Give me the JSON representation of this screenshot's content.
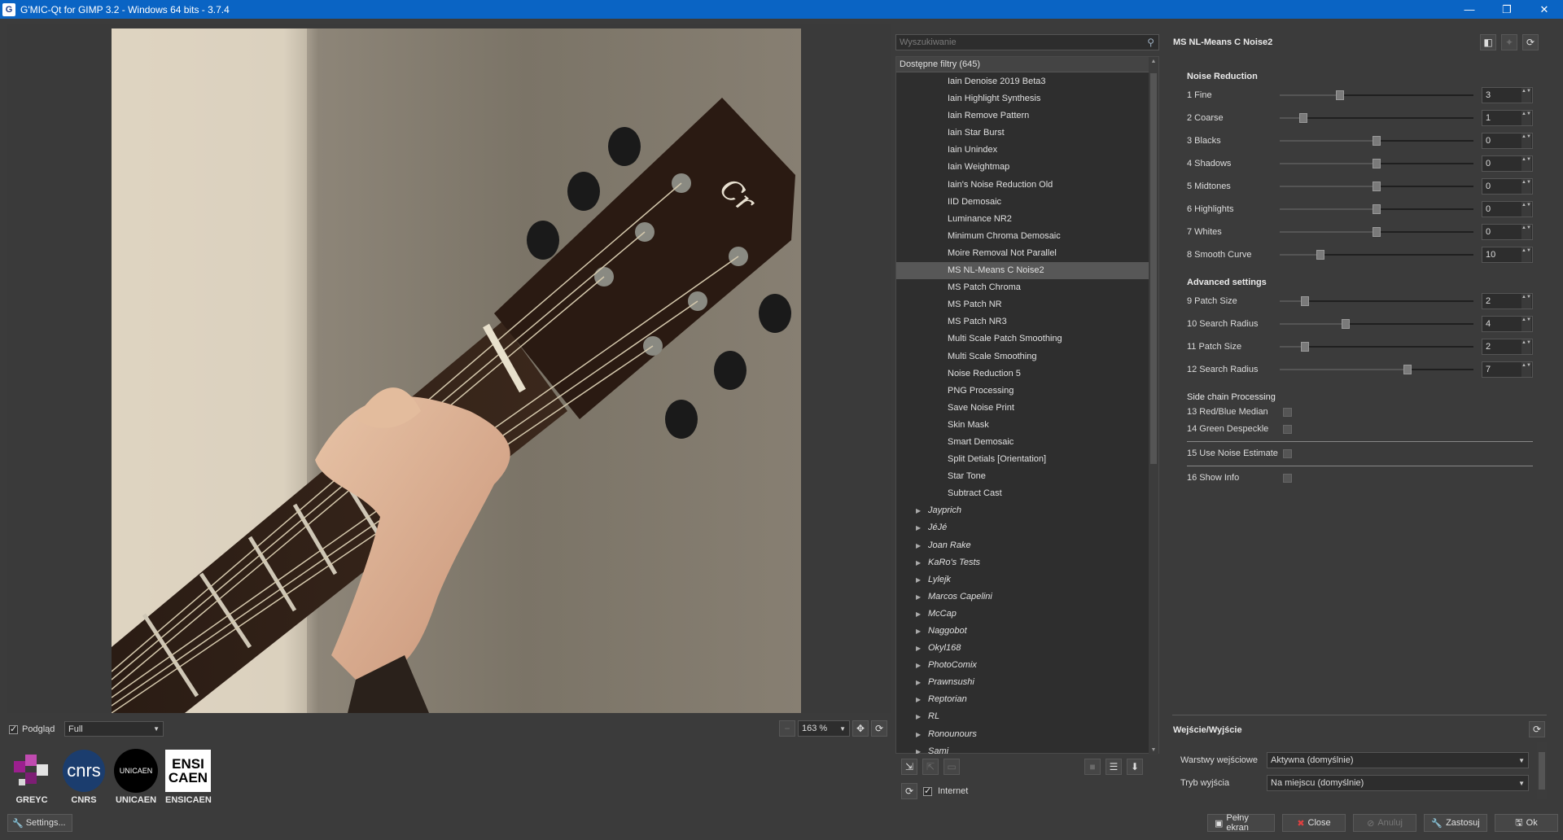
{
  "window": {
    "title": "G'MIC-Qt for GIMP 3.2 - Windows 64 bits - 3.7.4",
    "app_icon": "G",
    "minimize": "—",
    "maximize": "❐",
    "close": "✕"
  },
  "preview": {
    "checkbox_label": "Podgląd",
    "mode_value": "Full",
    "zoom_value": "163 %",
    "zoom_out_glyph": "−",
    "zoom_fit_glyph": "✥",
    "refresh_glyph": "⟳",
    "image_description": "guitar-headstock-photo"
  },
  "logos": [
    {
      "name": "GREYC"
    },
    {
      "name": "CNRS",
      "mark": "cnrs"
    },
    {
      "name": "UNICAEN",
      "mark": "UNICAEN"
    },
    {
      "name": "ENSICAEN",
      "mark_top": "ENSI",
      "mark_bottom": "CAEN"
    }
  ],
  "settings_button": "Settings...",
  "search": {
    "placeholder": "Wyszukiwanie",
    "icon": "⚲"
  },
  "filters": {
    "header": "Dostępne filtry (645)",
    "items": [
      {
        "label": "Iain Denoise 2019 Beta3",
        "type": "filter"
      },
      {
        "label": "Iain Highlight Synthesis",
        "type": "filter"
      },
      {
        "label": "Iain Remove Pattern",
        "type": "filter"
      },
      {
        "label": "Iain Star Burst",
        "type": "filter"
      },
      {
        "label": "Iain Unindex",
        "type": "filter"
      },
      {
        "label": "Iain Weightmap",
        "type": "filter"
      },
      {
        "label": "Iain's Noise Reduction Old",
        "type": "filter"
      },
      {
        "label": "IID Demosaic",
        "type": "filter"
      },
      {
        "label": "Luminance NR2",
        "type": "filter"
      },
      {
        "label": "Minimum Chroma Demosaic",
        "type": "filter"
      },
      {
        "label": "Moire Removal Not Parallel",
        "type": "filter"
      },
      {
        "label": "MS NL-Means C Noise2",
        "type": "filter",
        "selected": true
      },
      {
        "label": "MS Patch Chroma",
        "type": "filter"
      },
      {
        "label": "MS Patch NR",
        "type": "filter"
      },
      {
        "label": "MS Patch NR3",
        "type": "filter"
      },
      {
        "label": "Multi Scale Patch Smoothing",
        "type": "filter"
      },
      {
        "label": "Multi Scale Smoothing",
        "type": "filter"
      },
      {
        "label": "Noise Reduction 5",
        "type": "filter"
      },
      {
        "label": "PNG Processing",
        "type": "filter"
      },
      {
        "label": "Save Noise Print",
        "type": "filter"
      },
      {
        "label": "Skin Mask",
        "type": "filter"
      },
      {
        "label": "Smart Demosaic",
        "type": "filter"
      },
      {
        "label": "Split Detials [Orientation]",
        "type": "filter"
      },
      {
        "label": "Star Tone",
        "type": "filter"
      },
      {
        "label": "Subtract Cast",
        "type": "filter"
      },
      {
        "label": "Jayprich",
        "type": "folder"
      },
      {
        "label": "JéJé",
        "type": "folder"
      },
      {
        "label": "Joan Rake",
        "type": "folder"
      },
      {
        "label": "KaRo's Tests",
        "type": "folder"
      },
      {
        "label": "Lylejk",
        "type": "folder"
      },
      {
        "label": "Marcos Capelini",
        "type": "folder"
      },
      {
        "label": "McCap",
        "type": "folder"
      },
      {
        "label": "Naggobot",
        "type": "folder"
      },
      {
        "label": "Okyl168",
        "type": "folder"
      },
      {
        "label": "PhotoComix",
        "type": "folder"
      },
      {
        "label": "Prawnsushi",
        "type": "folder"
      },
      {
        "label": "Reptorian",
        "type": "folder"
      },
      {
        "label": "RL",
        "type": "folder"
      },
      {
        "label": "Ronounours",
        "type": "folder"
      },
      {
        "label": "Samj",
        "type": "folder"
      }
    ],
    "folder_arrow": "▶",
    "scroll_up": "▲",
    "scroll_down": "▼",
    "internet_label": "Internet",
    "tool_icons": [
      "add-fave-icon",
      "remove-fave-icon",
      "rename-fave-icon",
      "color-icon",
      "list-icon",
      "download-icon",
      "refresh-icon"
    ]
  },
  "params": {
    "title": "MS NL-Means C Noise2",
    "sections": {
      "noise_reduction": "Noise Reduction",
      "advanced": "Advanced settings",
      "side_chain": "Side chain Processing"
    },
    "sliders": [
      {
        "label": "1 Fine",
        "value": "3",
        "position": 0.31
      },
      {
        "label": "2 Coarse",
        "value": "1",
        "position": 0.12
      },
      {
        "label": "3 Blacks",
        "value": "0",
        "position": 0.5
      },
      {
        "label": "4 Shadows",
        "value": "0",
        "position": 0.5
      },
      {
        "label": "5 Midtones",
        "value": "0",
        "position": 0.5
      },
      {
        "label": "6 Highlights",
        "value": "0",
        "position": 0.5
      },
      {
        "label": "7 Whites",
        "value": "0",
        "position": 0.5
      },
      {
        "label": "8 Smooth Curve",
        "value": "10",
        "position": 0.21
      },
      {
        "label": "9 Patch Size",
        "value": "2",
        "position": 0.13
      },
      {
        "label": "10 Search Radius",
        "value": "4",
        "position": 0.34
      },
      {
        "label": "11 Patch Size",
        "value": "2",
        "position": 0.13
      },
      {
        "label": "12 Search Radius",
        "value": "7",
        "position": 0.66
      }
    ],
    "checks": [
      {
        "label": "13 Red/Blue Median",
        "checked": false
      },
      {
        "label": "14 Green Despeckle",
        "checked": false
      },
      {
        "label": "15 Use Noise Estimate",
        "checked": false
      },
      {
        "label": "16 Show Info",
        "checked": false
      }
    ],
    "spin_arrows": "▲▼"
  },
  "io": {
    "title": "Wejście/Wyjście",
    "input_label": "Warstwy wejściowe",
    "input_value": "Aktywna (domyślnie)",
    "output_label": "Tryb wyjścia",
    "output_value": "Na miejscu (domyślnie)"
  },
  "buttons": {
    "fullscreen": "Pełny ekran",
    "close": "Close",
    "cancel": "Anuluj",
    "apply": "Zastosuj",
    "ok": "Ok"
  }
}
